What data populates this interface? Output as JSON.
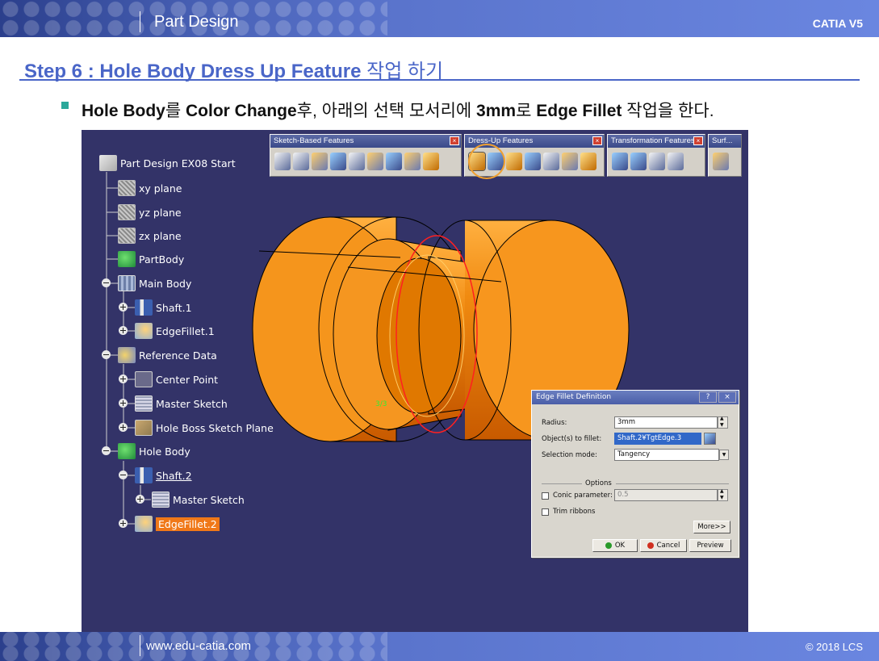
{
  "header": {
    "section_title": "Part Design",
    "product": "CATIA V5"
  },
  "step": {
    "title_en": "Step 6 : Hole Body Dress Up Feature",
    "title_kr": "작업 하기"
  },
  "instruction": {
    "part1": "Hole Body",
    "part2": "를 ",
    "part3": "Color Change",
    "part4": "후, 아래의 선택 모서리에 ",
    "part5": "3mm",
    "part6": "로 ",
    "part7": "Edge Fillet",
    "part8": " 작업을 한다."
  },
  "spec_tree": {
    "root": "Part Design EX08 Start",
    "items": [
      {
        "label": "xy plane",
        "icon": "plane-icon"
      },
      {
        "label": "yz plane",
        "icon": "plane-icon"
      },
      {
        "label": "zx plane",
        "icon": "plane-icon"
      },
      {
        "label": "PartBody",
        "icon": "partbody-icon"
      },
      {
        "label": "Main Body",
        "icon": "body-icon"
      },
      {
        "label": "Shaft.1",
        "icon": "shaft-icon"
      },
      {
        "label": "EdgeFillet.1",
        "icon": "edge-fillet-icon"
      },
      {
        "label": "Reference Data",
        "icon": "reference-icon"
      },
      {
        "label": "Center Point",
        "icon": "point-icon"
      },
      {
        "label": "Master Sketch",
        "icon": "sketch-icon"
      },
      {
        "label": "Hole Boss Sketch Plane",
        "icon": "plane-icon"
      },
      {
        "label": "Hole Body",
        "icon": "body-icon"
      },
      {
        "label": "Shaft.2",
        "icon": "shaft-icon"
      },
      {
        "label": "Master Sketch",
        "icon": "sketch-icon"
      },
      {
        "label": "EdgeFillet.2",
        "icon": "edge-fillet-icon"
      }
    ]
  },
  "toolbars": [
    {
      "title": "Sketch-Based Features",
      "icon_count": 9
    },
    {
      "title": "Dress-Up Features",
      "icon_count": 7
    },
    {
      "title": "Transformation Features",
      "icon_count": 4
    },
    {
      "title": "Surf...",
      "icon_count": 1
    }
  ],
  "model_label": "3/3",
  "dialog": {
    "title": "Edge Fillet Definition",
    "help": "?",
    "close": "×",
    "radius_label": "Radius:",
    "radius_value": "3mm",
    "objects_label": "Object(s) to fillet:",
    "objects_value": "Shaft.2¥TgtEdge.3",
    "selection_label": "Selection mode:",
    "selection_value": "Tangency",
    "options_label": "Options",
    "conic_label": "Conic parameter:",
    "conic_value": "0.5",
    "trim_label": "Trim ribbons",
    "more_label": "More>>",
    "ok_label": "OK",
    "cancel_label": "Cancel",
    "preview_label": "Preview"
  },
  "footer": {
    "url": "www.edu-catia.com",
    "copyright": "© 2018 LCS"
  },
  "colors": {
    "brand_blue": "#4a66c8",
    "viewport_bg": "#333368",
    "part_orange": "#f08a10",
    "selection_red": "#ff2020"
  }
}
